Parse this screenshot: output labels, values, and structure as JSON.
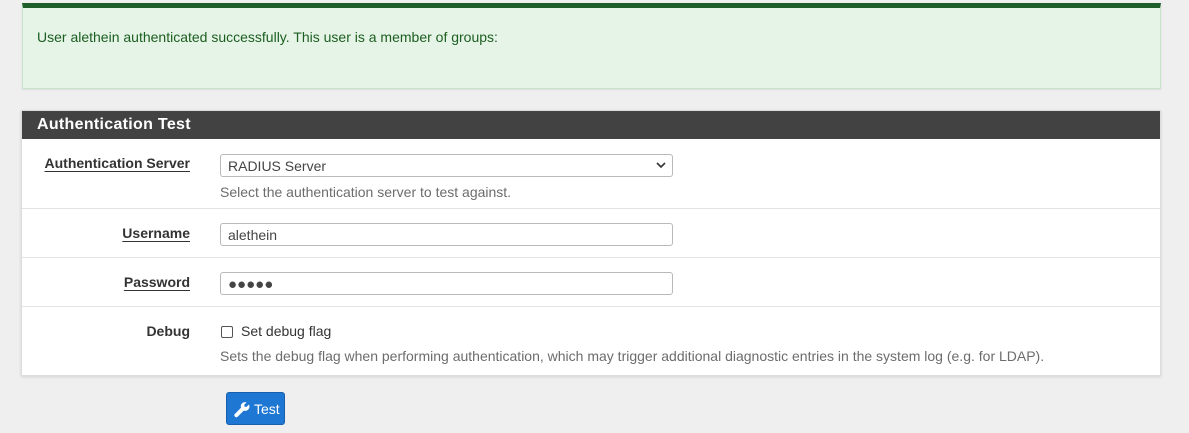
{
  "alert": {
    "message": "User alethein authenticated successfully. This user is a member of groups:"
  },
  "panel": {
    "title": "Authentication Test"
  },
  "form": {
    "auth_server": {
      "label": "Authentication Server",
      "value": "RADIUS Server",
      "help": "Select the authentication server to test against."
    },
    "username": {
      "label": "Username",
      "value": "alethein"
    },
    "password": {
      "label": "Password",
      "masked": "●●●●●"
    },
    "debug": {
      "label": "Debug",
      "checkbox_label": "Set debug flag",
      "checked": false,
      "help": "Sets the debug flag when performing authentication, which may trigger additional diagnostic entries in the system log (e.g. for LDAP)."
    }
  },
  "actions": {
    "test_label": "Test",
    "test_icon": "wrench-icon"
  },
  "colors": {
    "alert_bg": "#e6f4e7",
    "alert_border": "#1e5e2a",
    "panel_heading": "#424242",
    "primary_button": "#1e77d3"
  }
}
